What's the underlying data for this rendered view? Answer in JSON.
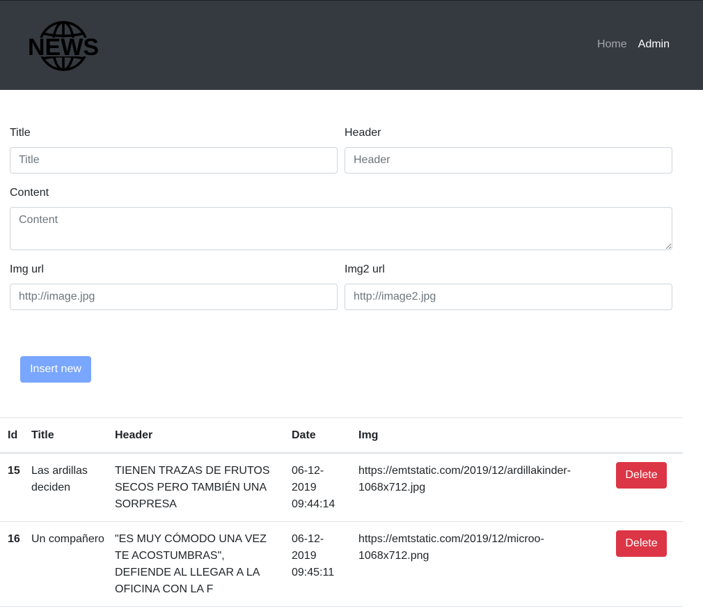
{
  "navbar": {
    "logo_text": "NEWS",
    "links": [
      {
        "label": "Home",
        "active": false
      },
      {
        "label": "Admin",
        "active": true
      }
    ],
    "bg_color": "#343a40"
  },
  "form": {
    "title": {
      "label": "Title",
      "placeholder": "Title",
      "value": ""
    },
    "header": {
      "label": "Header",
      "placeholder": "Header",
      "value": ""
    },
    "content": {
      "label": "Content",
      "placeholder": "Content",
      "value": ""
    },
    "img": {
      "label": "Img url",
      "placeholder": "http://image.jpg",
      "value": ""
    },
    "img2": {
      "label": "Img2 url",
      "placeholder": "http://image2.jpg",
      "value": ""
    },
    "submit_label": "Insert new"
  },
  "table": {
    "columns": [
      "Id",
      "Title",
      "Header",
      "Date",
      "Img",
      ""
    ],
    "rows": [
      {
        "id": "15",
        "title": "Las ardillas deciden",
        "header": "TIENEN TRAZAS DE FRUTOS SECOS PERO TAMBIÉN UNA SORPRESA",
        "date": "06-12-2019 09:44:14",
        "img": "https://emtstatic.com/2019/12/ardillakinder-1068x712.jpg",
        "action": "Delete"
      },
      {
        "id": "16",
        "title": "Un compañero",
        "header": "\"ES MUY CÓMODO UNA VEZ TE ACOSTUMBRAS\", DEFIENDE AL LLEGAR A LA OFICINA CON LA F",
        "date": "06-12-2019 09:45:11",
        "img": "https://emtstatic.com/2019/12/microo-1068x712.png",
        "action": "Delete"
      }
    ]
  },
  "colors": {
    "primary_disabled": "#79a6fe",
    "danger": "#dc3545"
  }
}
